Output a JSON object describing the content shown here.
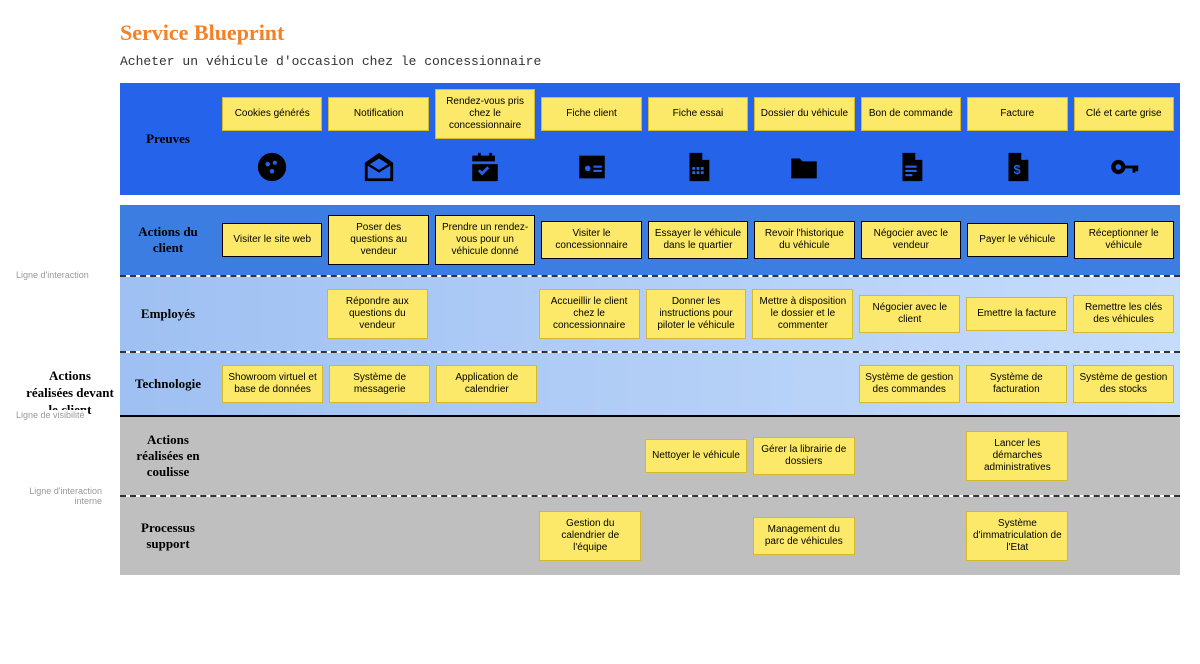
{
  "title": "Service Blueprint",
  "subtitle": "Acheter un véhicule d'occasion chez le concessionnaire",
  "lanes": {
    "evidence": {
      "label": "Preuves",
      "items": [
        "Cookies générés",
        "Notification",
        "Rendez-vous pris chez le concessionnaire",
        "Fiche client",
        "Fiche essai",
        "Dossier du véhicule",
        "Bon de commande",
        "Facture",
        "Clé et carte grise"
      ],
      "icons": [
        "cookie",
        "envelope",
        "calendar-check",
        "id-card",
        "file-grid",
        "folder",
        "document",
        "invoice",
        "key"
      ]
    },
    "customer": {
      "label": "Actions du client",
      "items": [
        "Visiter le site web",
        "Poser des questions au vendeur",
        "Prendre un rendez-vous pour un véhicule donné",
        "Visiter le concessionnaire",
        "Essayer le véhicule dans le quartier",
        "Revoir l'historique du véhicule",
        "Négocier avec le vendeur",
        "Payer le véhicule",
        "Réceptionner le véhicule"
      ]
    },
    "employees": {
      "label": "Employés",
      "items": [
        "",
        "Répondre aux questions du vendeur",
        "",
        "Accueillir le client chez le concessionnaire",
        "Donner les instructions pour piloter le véhicule",
        "Mettre à disposition le dossier et le commenter",
        "Négocier avec le client",
        "Emettre la facture",
        "Remettre les clés des véhicules"
      ]
    },
    "technology": {
      "label": "Technologie",
      "items": [
        "Showroom virtuel et base de données",
        "Système de messagerie",
        "Application de calendrier",
        "",
        "",
        "",
        "Système de gestion des commandes",
        "Système de facturation",
        "Système de gestion des stocks"
      ]
    },
    "backstage": {
      "label": "Actions réalisées en coulisse",
      "items": [
        "",
        "",
        "",
        "",
        "Nettoyer le véhicule",
        "Gérer la librairie de dossiers",
        "",
        "Lancer les démarches administratives",
        ""
      ]
    },
    "support": {
      "label": "Processus support",
      "items": [
        "",
        "",
        "",
        "Gestion du calendrier de l'équipe",
        "",
        "Management du parc de véhicules",
        "",
        "Système d'immatriculation de l'Etat",
        ""
      ]
    }
  },
  "side_label": "Actions réalisées devant le client",
  "dividers": {
    "interaction": "Ligne d'interaction",
    "visibility": "Ligne de visibilité",
    "internal": "Ligne d'interaction interne"
  }
}
